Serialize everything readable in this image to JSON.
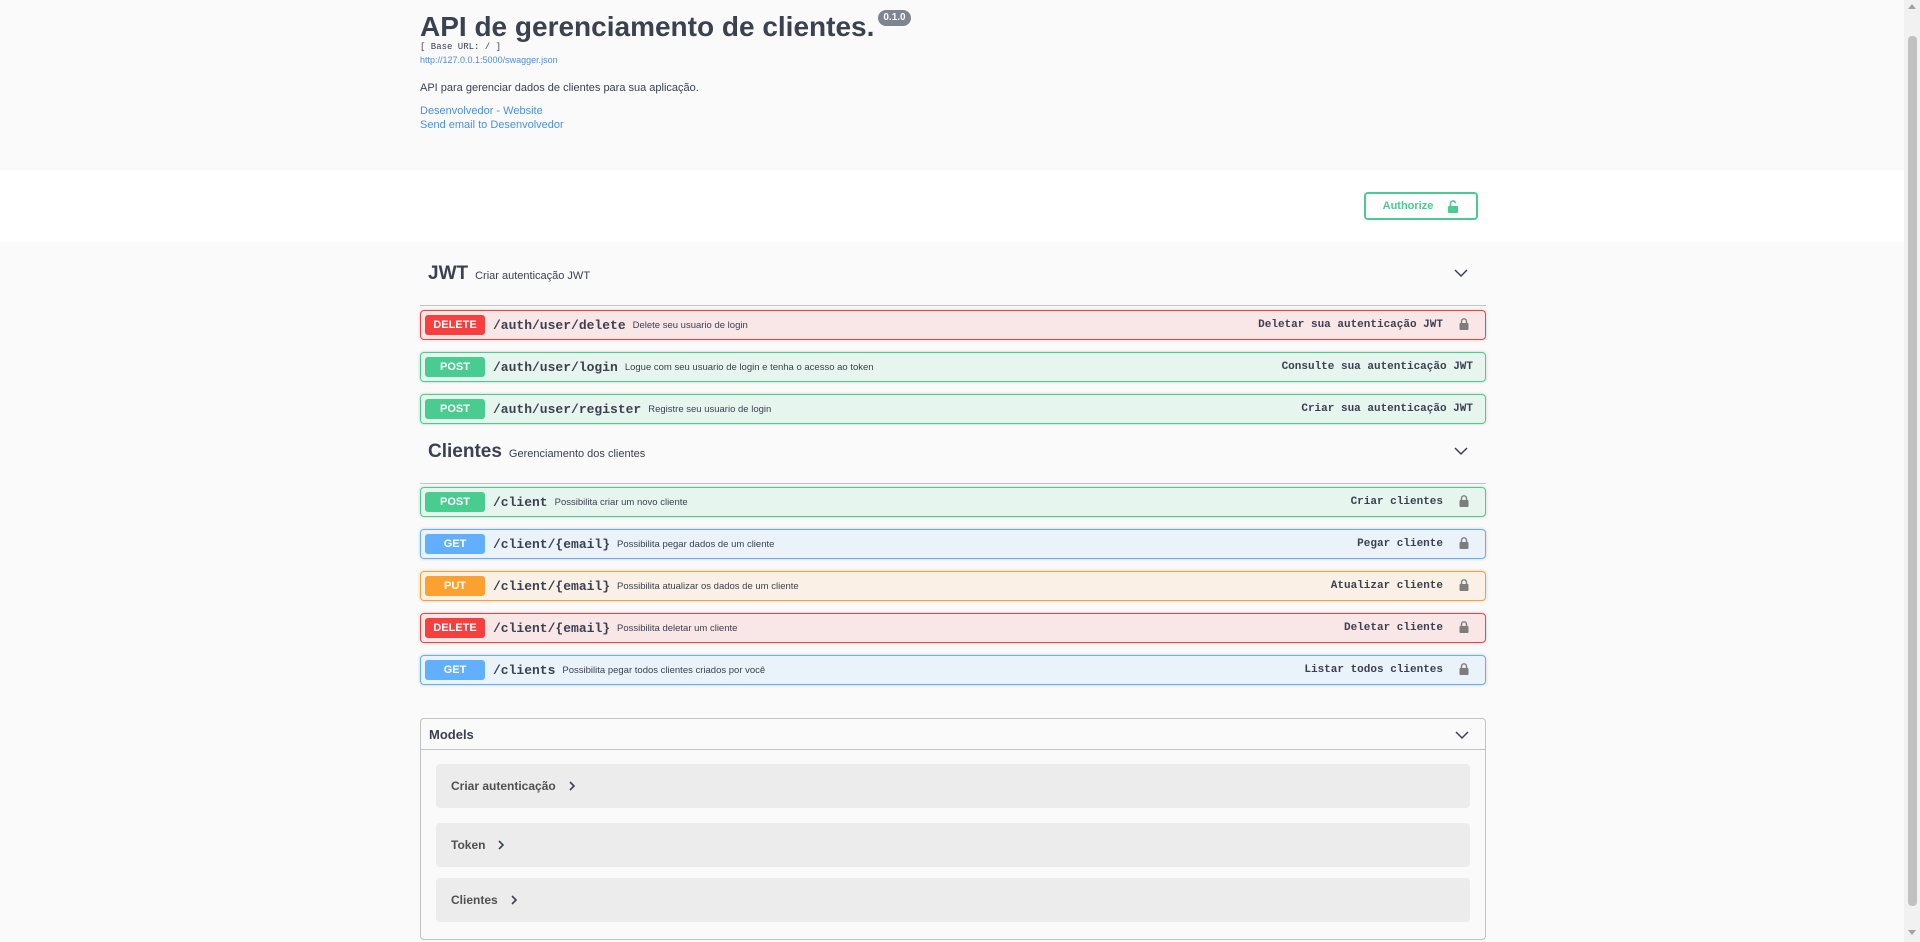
{
  "info": {
    "title": "API de gerenciamento de clientes.",
    "version": "0.1.0",
    "base_url": "[ Base URL: / ]",
    "spec_url": "http://127.0.0.1:5000/swagger.json",
    "description": "API para gerenciar dados de clientes para sua aplicação.",
    "contact_website": "Desenvolvedor - Website",
    "contact_email": "Send email to Desenvolvedor"
  },
  "authorize_label": "Authorize",
  "tags": [
    {
      "name": "JWT",
      "description": "Criar autenticação JWT",
      "operations": [
        {
          "method": "DELETE",
          "path": "/auth/user/delete",
          "summary": "Delete seu usuario de login",
          "right": "Deletar sua autenticação JWT",
          "locked": true
        },
        {
          "method": "POST",
          "path": "/auth/user/login",
          "summary": "Logue com seu usuario de login e tenha o acesso ao token",
          "right": "Consulte sua autenticação JWT",
          "locked": false
        },
        {
          "method": "POST",
          "path": "/auth/user/register",
          "summary": "Registre seu usuario de login",
          "right": "Criar sua autenticação JWT",
          "locked": false
        }
      ]
    },
    {
      "name": "Clientes",
      "description": "Gerenciamento dos clientes",
      "operations": [
        {
          "method": "POST",
          "path": "/client",
          "summary": "Possibilita criar um novo cliente",
          "right": "Criar clientes",
          "locked": true
        },
        {
          "method": "GET",
          "path": "/client/{email}",
          "summary": "Possibilita pegar dados de um cliente",
          "right": "Pegar cliente",
          "locked": true
        },
        {
          "method": "PUT",
          "path": "/client/{email}",
          "summary": "Possibilita atualizar os dados de um cliente",
          "right": "Atualizar cliente",
          "locked": true
        },
        {
          "method": "DELETE",
          "path": "/client/{email}",
          "summary": "Possibilita deletar um cliente",
          "right": "Deletar cliente",
          "locked": true
        },
        {
          "method": "GET",
          "path": "/clients",
          "summary": "Possibilita pegar todos clientes criados por você",
          "right": "Listar todos clientes",
          "locked": true
        }
      ]
    }
  ],
  "models": {
    "title": "Models",
    "items": [
      "Criar autenticação",
      "Token",
      "Clientes"
    ]
  },
  "colors": {
    "post": "#49cc90",
    "get": "#61affe",
    "put": "#fca130",
    "delete": "#f93e3e",
    "link": "#4990e2"
  }
}
